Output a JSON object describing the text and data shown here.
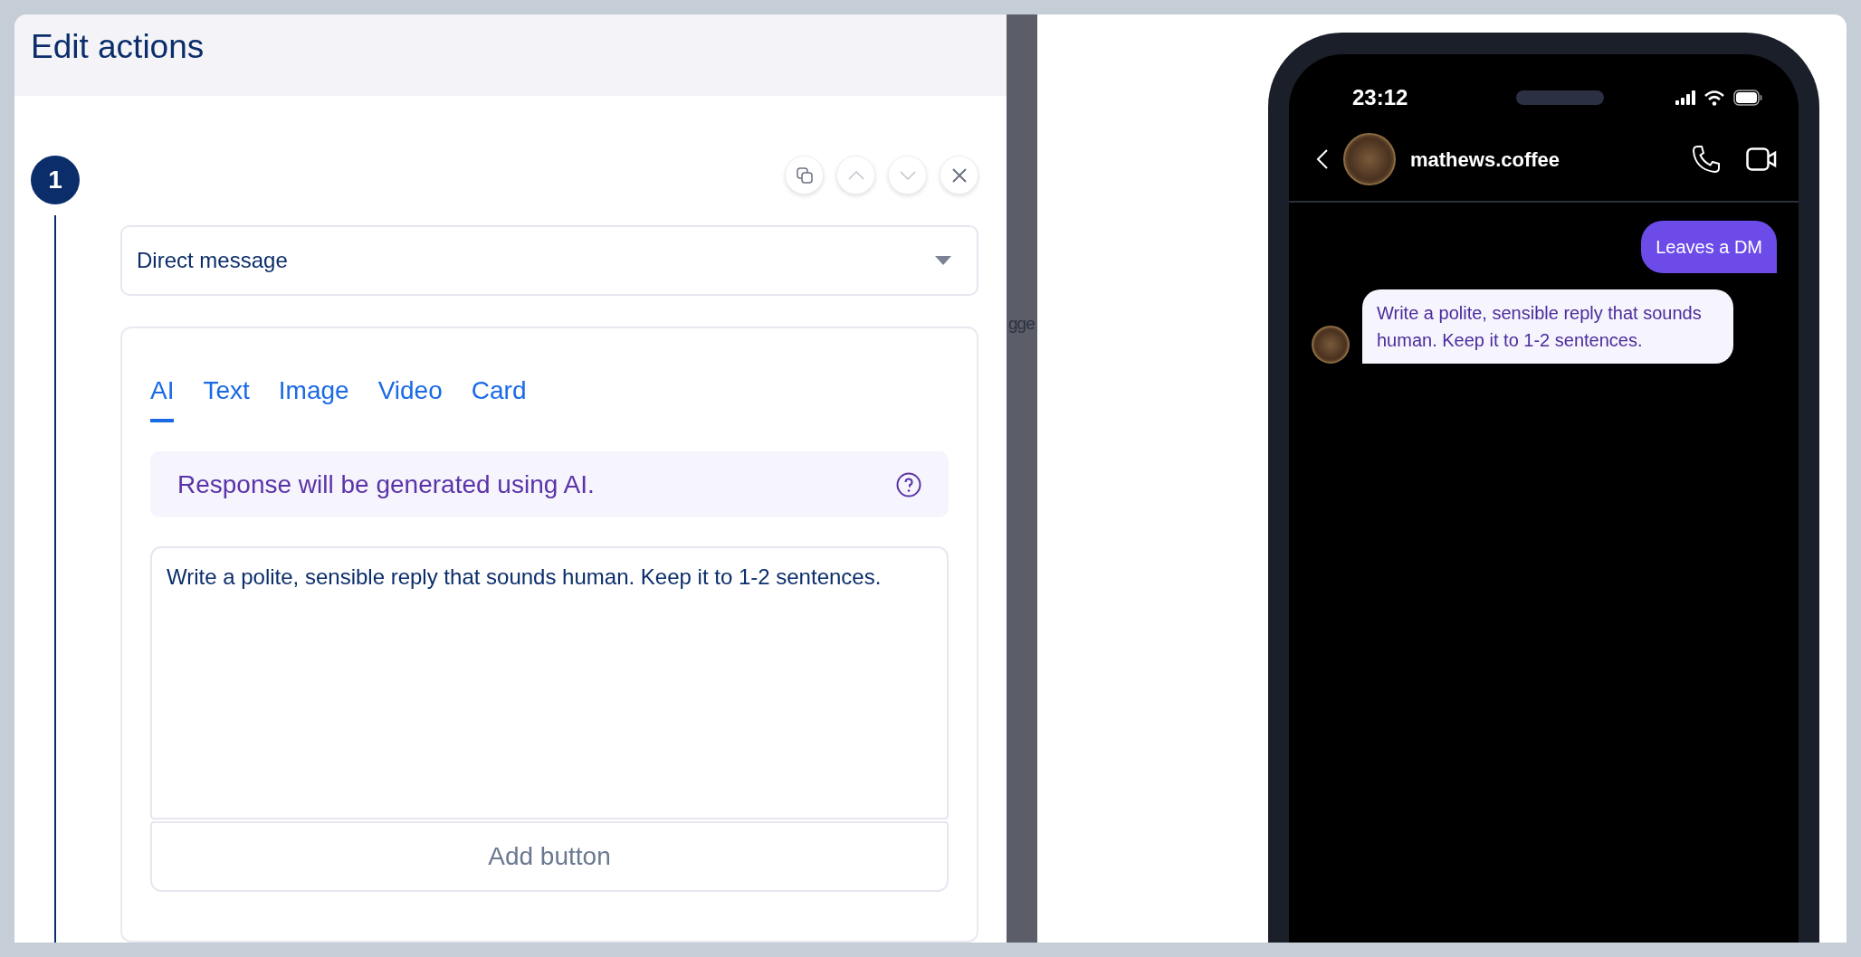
{
  "panel": {
    "title": "Edit actions"
  },
  "step": {
    "number": "1"
  },
  "action": {
    "type_select": {
      "value": "Direct message"
    },
    "tabs": [
      {
        "label": "AI",
        "selected": true
      },
      {
        "label": "Text",
        "selected": false
      },
      {
        "label": "Image",
        "selected": false
      },
      {
        "label": "Video",
        "selected": false
      },
      {
        "label": "Card",
        "selected": false
      }
    ],
    "info": "Response will be generated using AI.",
    "prompt": "Write a polite, sensible reply that sounds human. Keep it to 1-2 sentences.",
    "add_button": "Add button"
  },
  "background_text": "gge",
  "phone": {
    "time": "23:12",
    "contact": "mathews.coffee",
    "messages": [
      {
        "kind": "sent",
        "text": "Leaves a DM"
      },
      {
        "kind": "received",
        "text": "Write a polite, sensible reply that sounds human. Keep it to 1-2 sentences."
      }
    ]
  }
}
